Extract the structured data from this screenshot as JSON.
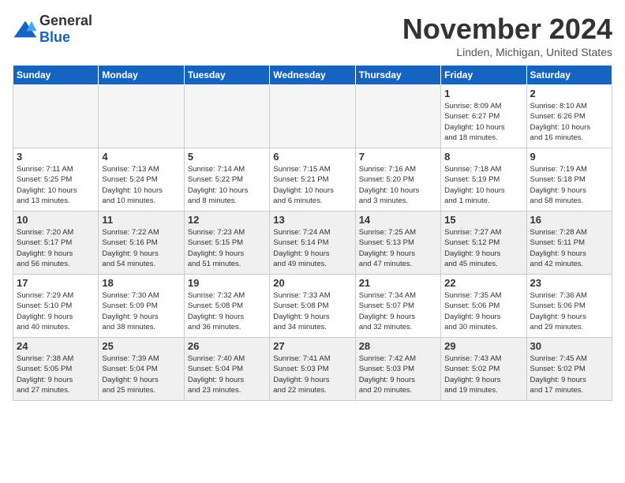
{
  "header": {
    "logo_general": "General",
    "logo_blue": "Blue",
    "month": "November 2024",
    "location": "Linden, Michigan, United States"
  },
  "weekdays": [
    "Sunday",
    "Monday",
    "Tuesday",
    "Wednesday",
    "Thursday",
    "Friday",
    "Saturday"
  ],
  "weeks": [
    [
      {
        "day": "",
        "info": ""
      },
      {
        "day": "",
        "info": ""
      },
      {
        "day": "",
        "info": ""
      },
      {
        "day": "",
        "info": ""
      },
      {
        "day": "",
        "info": ""
      },
      {
        "day": "1",
        "info": "Sunrise: 8:09 AM\nSunset: 6:27 PM\nDaylight: 10 hours\nand 18 minutes."
      },
      {
        "day": "2",
        "info": "Sunrise: 8:10 AM\nSunset: 6:26 PM\nDaylight: 10 hours\nand 16 minutes."
      }
    ],
    [
      {
        "day": "3",
        "info": "Sunrise: 7:11 AM\nSunset: 5:25 PM\nDaylight: 10 hours\nand 13 minutes."
      },
      {
        "day": "4",
        "info": "Sunrise: 7:13 AM\nSunset: 5:24 PM\nDaylight: 10 hours\nand 10 minutes."
      },
      {
        "day": "5",
        "info": "Sunrise: 7:14 AM\nSunset: 5:22 PM\nDaylight: 10 hours\nand 8 minutes."
      },
      {
        "day": "6",
        "info": "Sunrise: 7:15 AM\nSunset: 5:21 PM\nDaylight: 10 hours\nand 6 minutes."
      },
      {
        "day": "7",
        "info": "Sunrise: 7:16 AM\nSunset: 5:20 PM\nDaylight: 10 hours\nand 3 minutes."
      },
      {
        "day": "8",
        "info": "Sunrise: 7:18 AM\nSunset: 5:19 PM\nDaylight: 10 hours\nand 1 minute."
      },
      {
        "day": "9",
        "info": "Sunrise: 7:19 AM\nSunset: 5:18 PM\nDaylight: 9 hours\nand 58 minutes."
      }
    ],
    [
      {
        "day": "10",
        "info": "Sunrise: 7:20 AM\nSunset: 5:17 PM\nDaylight: 9 hours\nand 56 minutes."
      },
      {
        "day": "11",
        "info": "Sunrise: 7:22 AM\nSunset: 5:16 PM\nDaylight: 9 hours\nand 54 minutes."
      },
      {
        "day": "12",
        "info": "Sunrise: 7:23 AM\nSunset: 5:15 PM\nDaylight: 9 hours\nand 51 minutes."
      },
      {
        "day": "13",
        "info": "Sunrise: 7:24 AM\nSunset: 5:14 PM\nDaylight: 9 hours\nand 49 minutes."
      },
      {
        "day": "14",
        "info": "Sunrise: 7:25 AM\nSunset: 5:13 PM\nDaylight: 9 hours\nand 47 minutes."
      },
      {
        "day": "15",
        "info": "Sunrise: 7:27 AM\nSunset: 5:12 PM\nDaylight: 9 hours\nand 45 minutes."
      },
      {
        "day": "16",
        "info": "Sunrise: 7:28 AM\nSunset: 5:11 PM\nDaylight: 9 hours\nand 42 minutes."
      }
    ],
    [
      {
        "day": "17",
        "info": "Sunrise: 7:29 AM\nSunset: 5:10 PM\nDaylight: 9 hours\nand 40 minutes."
      },
      {
        "day": "18",
        "info": "Sunrise: 7:30 AM\nSunset: 5:09 PM\nDaylight: 9 hours\nand 38 minutes."
      },
      {
        "day": "19",
        "info": "Sunrise: 7:32 AM\nSunset: 5:08 PM\nDaylight: 9 hours\nand 36 minutes."
      },
      {
        "day": "20",
        "info": "Sunrise: 7:33 AM\nSunset: 5:08 PM\nDaylight: 9 hours\nand 34 minutes."
      },
      {
        "day": "21",
        "info": "Sunrise: 7:34 AM\nSunset: 5:07 PM\nDaylight: 9 hours\nand 32 minutes."
      },
      {
        "day": "22",
        "info": "Sunrise: 7:35 AM\nSunset: 5:06 PM\nDaylight: 9 hours\nand 30 minutes."
      },
      {
        "day": "23",
        "info": "Sunrise: 7:36 AM\nSunset: 5:06 PM\nDaylight: 9 hours\nand 29 minutes."
      }
    ],
    [
      {
        "day": "24",
        "info": "Sunrise: 7:38 AM\nSunset: 5:05 PM\nDaylight: 9 hours\nand 27 minutes."
      },
      {
        "day": "25",
        "info": "Sunrise: 7:39 AM\nSunset: 5:04 PM\nDaylight: 9 hours\nand 25 minutes."
      },
      {
        "day": "26",
        "info": "Sunrise: 7:40 AM\nSunset: 5:04 PM\nDaylight: 9 hours\nand 23 minutes."
      },
      {
        "day": "27",
        "info": "Sunrise: 7:41 AM\nSunset: 5:03 PM\nDaylight: 9 hours\nand 22 minutes."
      },
      {
        "day": "28",
        "info": "Sunrise: 7:42 AM\nSunset: 5:03 PM\nDaylight: 9 hours\nand 20 minutes."
      },
      {
        "day": "29",
        "info": "Sunrise: 7:43 AM\nSunset: 5:02 PM\nDaylight: 9 hours\nand 19 minutes."
      },
      {
        "day": "30",
        "info": "Sunrise: 7:45 AM\nSunset: 5:02 PM\nDaylight: 9 hours\nand 17 minutes."
      }
    ]
  ]
}
